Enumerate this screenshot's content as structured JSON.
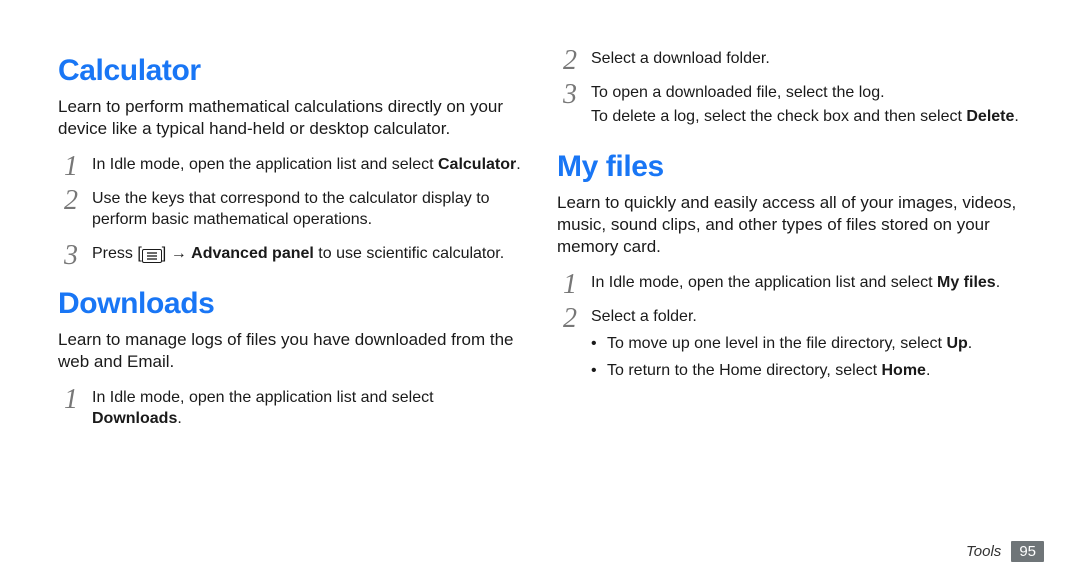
{
  "left": {
    "calc": {
      "heading": "Calculator",
      "intro": "Learn to perform mathematical calculations directly on your device like a typical hand-held or desktop calculator.",
      "steps": {
        "s1_a": "In Idle mode, open the application list and select ",
        "s1_bold": "Calculator",
        "s1_b": ".",
        "s2": "Use the keys that correspond to the calculator display to perform basic mathematical operations.",
        "s3_a": "Press [",
        "s3_b": "] → ",
        "s3_bold": "Advanced panel",
        "s3_c": " to use scientific calculator."
      }
    },
    "dl": {
      "heading": "Downloads",
      "intro": "Learn to manage logs of files you have downloaded from the web and Email.",
      "steps": {
        "s1_a": "In Idle mode, open the application list and select ",
        "s1_bold": "Downloads",
        "s1_b": "."
      }
    }
  },
  "right": {
    "dlcont": {
      "s2": "Select a download folder.",
      "s3_a": "To open a downloaded file, select the log.",
      "s3_b_a": "To delete a log, select the check box and then select ",
      "s3_b_bold": "Delete",
      "s3_b_b": "."
    },
    "myfiles": {
      "heading": "My files",
      "intro": "Learn to quickly and easily access all of your images, videos, music, sound clips, and other types of files stored on your memory card.",
      "steps": {
        "s1_a": "In Idle mode, open the application list and select ",
        "s1_bold": "My files",
        "s1_b": ".",
        "s2": "Select a folder.",
        "b1_a": "To move up one level in the file directory, select ",
        "b1_bold": "Up",
        "b1_b": ".",
        "b2_a": "To return to the Home directory, select ",
        "b2_bold": "Home",
        "b2_b": "."
      }
    }
  },
  "footer": {
    "section": "Tools",
    "page": "95"
  }
}
